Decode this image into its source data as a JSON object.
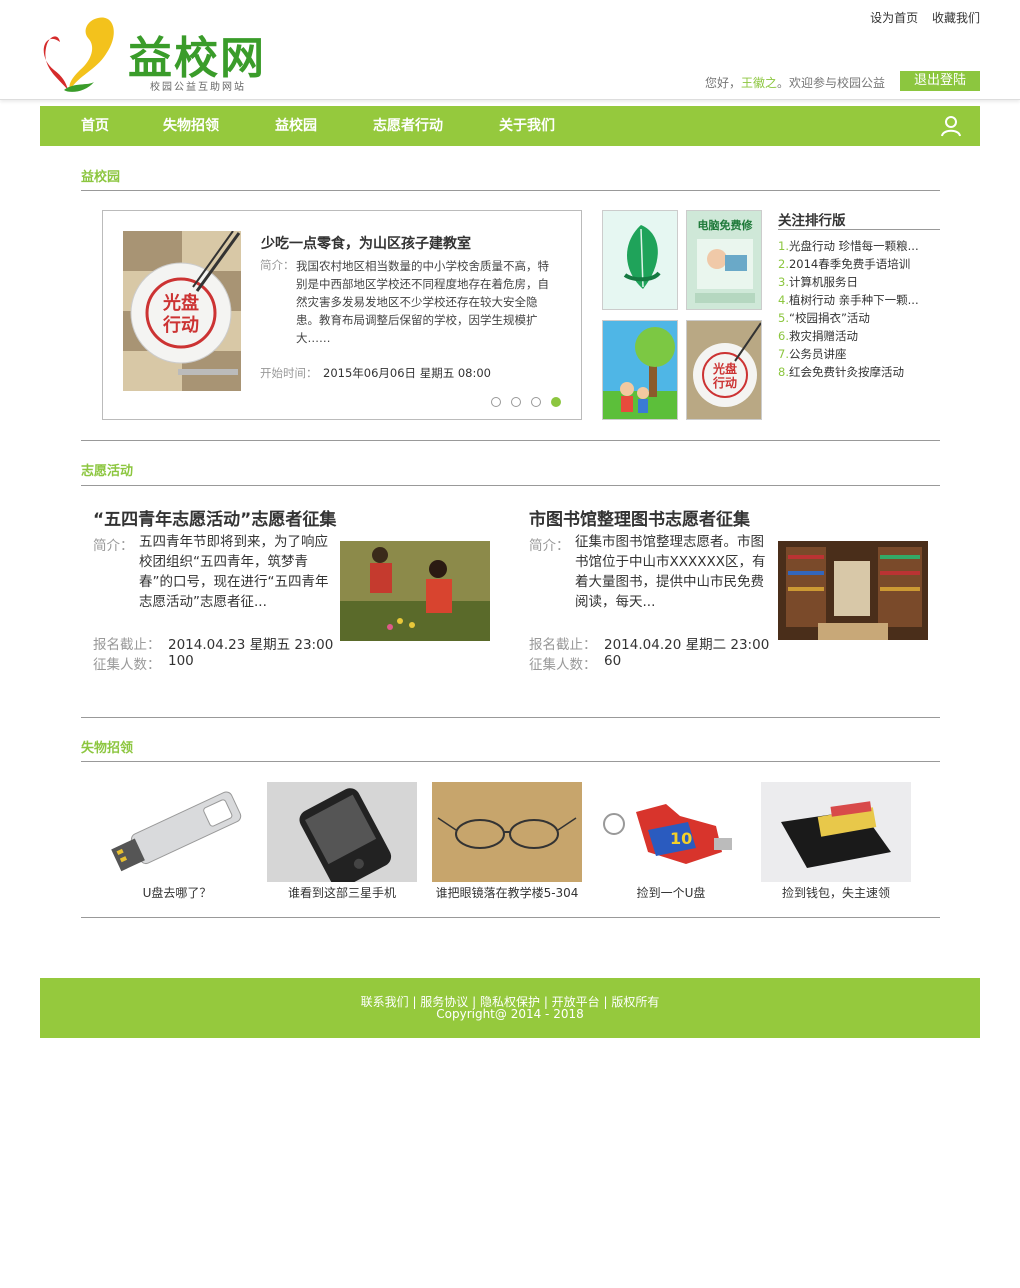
{
  "header": {
    "logo_text": "益校网",
    "logo_sub": "校园公益互助网站",
    "set_home": "设为首页",
    "bookmark": "收藏我们",
    "greet_prefix": "您好，",
    "username": "王徽之",
    "greet_suffix": "。欢迎参与校园公益",
    "logout": "退出登陆"
  },
  "nav": {
    "items": [
      "首页",
      "失物招领",
      "益校园",
      "志愿者行动",
      "关于我们"
    ],
    "user_icon": "user-icon"
  },
  "yixiaoyuan": {
    "section_title": "益校园",
    "carousel": {
      "title": "少吃一点零食，为山区孩子建教室",
      "desc_label": "简介：",
      "desc": "我国农村地区相当数量的中小学校舍质量不高，特别是中西部地区学校还不同程度地存在着危房，自然灾害多发易发地区不少学校还存在较大安全隐患。教育布局调整后保留的学校，因学生规模扩大……",
      "time_label": "开始时间：",
      "time": "2015年06月06日   星期五   08:00",
      "image_text": "光盘\n行动",
      "active_dot": 4,
      "dot_count": 4
    },
    "thumbs": [
      {
        "label": "leaf-poster"
      },
      {
        "label": "电脑免费修"
      },
      {
        "label": "children-tree"
      },
      {
        "label": "光盘行动"
      }
    ],
    "ranking": {
      "title": "关注排行版",
      "items": [
        {
          "num": "1.",
          "text": "光盘行动 珍惜每一颗粮..."
        },
        {
          "num": "2.",
          "text": "2014春季免费手语培训"
        },
        {
          "num": "3.",
          "text": "计算机服务日"
        },
        {
          "num": "4.",
          "text": "植树行动 亲手种下一颗..."
        },
        {
          "num": "5.",
          "text": "“校园捐衣”活动"
        },
        {
          "num": "6.",
          "text": "救灾捐赠活动"
        },
        {
          "num": "7.",
          "text": "公务员讲座"
        },
        {
          "num": "8.",
          "text": "红会免费针灸按摩活动"
        }
      ]
    }
  },
  "volunteer": {
    "section_title": "志愿活动",
    "items": [
      {
        "title": "“五四青年志愿活动”志愿者征集",
        "desc_label": "简介：",
        "desc": "五四青年节即将到来，为了响应校团组织“五四青年，筑梦青春”的口号，现在进行“五四青年志愿活动”志愿者征...",
        "deadline_label": "报名截止：",
        "deadline": "2014.04.23  星期五  23:00",
        "count_label": "征集人数：",
        "count": "100"
      },
      {
        "title": "市图书馆整理图书志愿者征集",
        "desc_label": "简介：",
        "desc": "征集市图书馆整理志愿者。市图书馆位于中山市XXXXXX区，有着大量图书，提供中山市民免费阅读，每天...",
        "deadline_label": "报名截止：",
        "deadline": "2014.04.20  星期二  23:00",
        "count_label": "征集人数：",
        "count": "60"
      }
    ]
  },
  "lost_found": {
    "section_title": "失物招领",
    "items": [
      {
        "caption": "U盘去哪了？"
      },
      {
        "caption": "谁看到这部三星手机"
      },
      {
        "caption": "谁把眼镜落在教学楼5-304"
      },
      {
        "caption": "捡到一个U盘"
      },
      {
        "caption": "捡到钱包，失主速领"
      }
    ]
  },
  "footer": {
    "links": [
      "联系我们",
      "服务协议",
      "隐私权保护",
      "开放平台",
      "版权所有"
    ],
    "separator": " | ",
    "copyright": "Copyright@ 2014 - 2018"
  },
  "colors": {
    "accent": "#95c93d",
    "accent_text": "#8cc63f",
    "logo_green": "#3a9c2a"
  }
}
